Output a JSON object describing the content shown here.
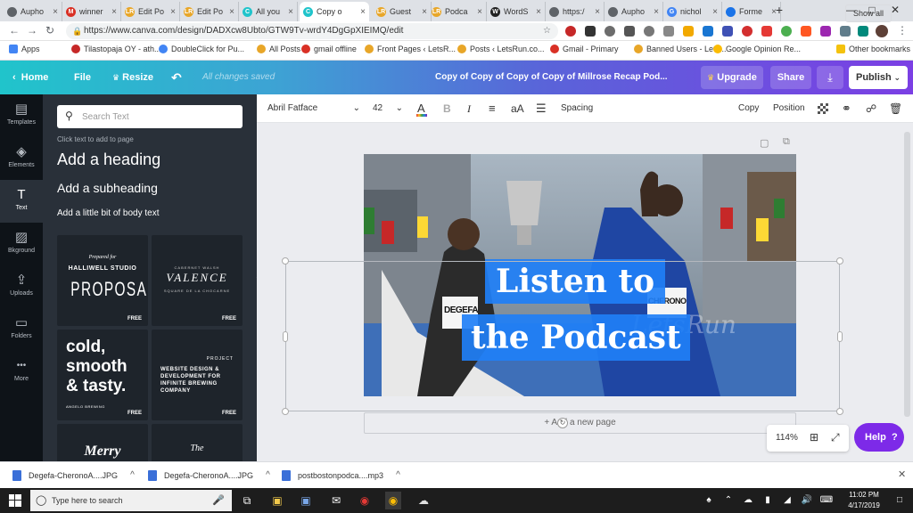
{
  "browser": {
    "tabs": [
      {
        "title": "Aupho",
        "color": "#5f6368",
        "letter": ""
      },
      {
        "title": "winner",
        "color": "#d93025",
        "letter": "M"
      },
      {
        "title": "Edit Po",
        "color": "#e8a628",
        "letter": "LR"
      },
      {
        "title": "Edit Po",
        "color": "#e8a628",
        "letter": "LR"
      },
      {
        "title": "All you",
        "color": "#20c4cb",
        "letter": "C"
      },
      {
        "title": "Copy o",
        "color": "#20c4cb",
        "letter": "C"
      },
      {
        "title": "Guest",
        "color": "#e8a628",
        "letter": "LR"
      },
      {
        "title": "Podca",
        "color": "#e8a628",
        "letter": "LR"
      },
      {
        "title": "WordS",
        "color": "#222222",
        "letter": "W"
      },
      {
        "title": "https:/",
        "color": "#5f6368",
        "letter": ""
      },
      {
        "title": "Aupho",
        "color": "#5f6368",
        "letter": ""
      },
      {
        "title": "nichol",
        "color": "#4285f4",
        "letter": "G"
      },
      {
        "title": "Forme",
        "color": "#1a73e8",
        "letter": ""
      }
    ],
    "new_tab": "+",
    "url": "https://www.canva.com/design/DADXcw8Ubto/GTW9Tv-wrdY4DgGpXIEIMQ/edit",
    "bookmarks": [
      {
        "label": "Apps",
        "color": "#4285f4"
      },
      {
        "label": "Tilastopaja OY - ath...",
        "color": "#c62828"
      },
      {
        "label": "DoubleClick for Pu...",
        "color": "#4285f4"
      },
      {
        "label": "All Posts",
        "color": "#e8a628"
      },
      {
        "label": "gmail offline",
        "color": "#d93025"
      },
      {
        "label": "Front Pages ‹ LetsR...",
        "color": "#e8a628"
      },
      {
        "label": "Posts ‹ LetsRun.co...",
        "color": "#e8a628"
      },
      {
        "label": "Gmail - Primary",
        "color": "#d93025"
      },
      {
        "label": "Banned Users - Lets...",
        "color": "#e8a628"
      },
      {
        "label": "Google Opinion Re...",
        "color": "#fbbc04"
      },
      {
        "label": "Other bookmarks",
        "color": "#f4c20d"
      }
    ]
  },
  "canva": {
    "home": "Home",
    "file": "File",
    "resize": "Resize",
    "saved_status": "All changes saved",
    "doc_title": "Copy of Copy of Copy of Copy of Millrose Recap Pod...",
    "upgrade": "Upgrade",
    "share": "Share",
    "publish": "Publish",
    "rail": [
      {
        "label": "Templates",
        "icon": "▤"
      },
      {
        "label": "Elements",
        "icon": "◈"
      },
      {
        "label": "Text",
        "icon": "T"
      },
      {
        "label": "Bkground",
        "icon": "▨"
      },
      {
        "label": "Uploads",
        "icon": "⇪"
      },
      {
        "label": "Folders",
        "icon": "▭"
      },
      {
        "label": "More",
        "icon": "•••"
      }
    ],
    "panel": {
      "search_placeholder": "Search Text",
      "hint": "Click text to add to page",
      "add_heading": "Add a heading",
      "add_subheading": "Add a subheading",
      "add_body": "Add a little bit of body text",
      "free_label": "FREE",
      "tile1": {
        "top": "Prepared for",
        "mid": "HALLIWELL STUDIO",
        "big": "PROPOSAL"
      },
      "tile2": {
        "top": "CABERNET WALSH",
        "big": "VALENCE",
        "bottom": "SQUARE DE LA CHOCARNE"
      },
      "tile3": {
        "big1": "cold,",
        "big2": "smooth",
        "big3": "& tasty.",
        "bottom": "ANGELO BREWING"
      },
      "tile4": {
        "top": "PROJECT",
        "l1": "WEBSITE DESIGN &",
        "l2": "DEVELOPMENT FOR",
        "l3": "INFINITE BREWING",
        "l4": "COMPANY"
      },
      "tile5": {
        "big": "Merry"
      },
      "tile6": {
        "top": "The"
      }
    },
    "toolbar": {
      "font": "Abril Fatface",
      "size": "42",
      "case": "aA",
      "spacing": "Spacing",
      "copy": "Copy",
      "position": "Position"
    },
    "design": {
      "line1": "Listen to",
      "line2": "the Podcast",
      "watermark": "LetsRun",
      "bib_left": "DEGEFA",
      "bib_right": "CHERONO"
    },
    "add_page": "+ Add a new page",
    "zoom": "114%",
    "help": "Help",
    "help_mark": "?"
  },
  "downloads": [
    {
      "name": "Degefa-CheronoA....JPG"
    },
    {
      "name": "Degefa-CheronoA....JPG"
    },
    {
      "name": "postbostonpodca....mp3"
    }
  ],
  "show_all": "Show all",
  "taskbar": {
    "search_placeholder": "Type here to search",
    "time": "11:02 PM",
    "date": "4/17/2019"
  }
}
